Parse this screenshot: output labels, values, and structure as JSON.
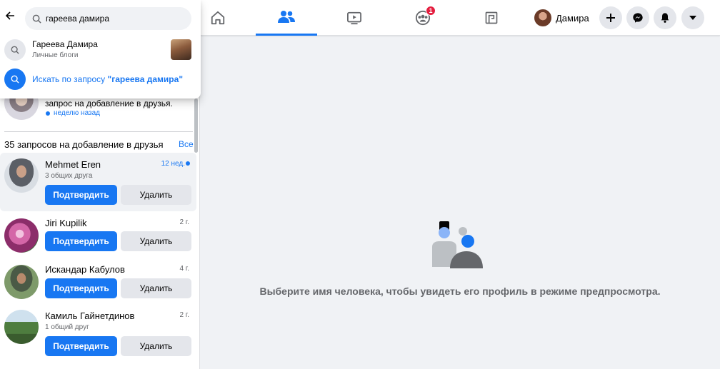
{
  "search": {
    "query": "гареева дамира",
    "suggestion": {
      "title": "Гареева Дамира",
      "subtitle": "Личные блоги"
    },
    "search_for_prefix": "Искать по запросу ",
    "search_for_query": "\"гареева дамира\""
  },
  "nav": {
    "tabs": [
      {
        "icon": "home-icon",
        "active": false
      },
      {
        "icon": "friends-icon",
        "active": true
      },
      {
        "icon": "watch-icon",
        "active": false
      },
      {
        "icon": "groups-icon",
        "active": false,
        "badge": "1"
      },
      {
        "icon": "gaming-icon",
        "active": false
      }
    ],
    "profile_name": "Дамира",
    "actions": [
      "plus-icon",
      "messenger-icon",
      "bell-icon",
      "caret-down-icon"
    ]
  },
  "notification": {
    "text": "запрос на добавление в друзья.",
    "time": "неделю назад"
  },
  "requests": {
    "title": "35 запросов на добавление в друзья",
    "see_all": "Все",
    "confirm_label": "Подтвердить",
    "delete_label": "Удалить",
    "items": [
      {
        "name": "Mehmet Eren",
        "time": "12 нед.",
        "mutual": "3 общих друга",
        "unread": true
      },
      {
        "name": "Jiri Kupilik",
        "time": "2 г.",
        "mutual": ""
      },
      {
        "name": "Искандар Кабулов",
        "time": "4 г.",
        "mutual": ""
      },
      {
        "name": "Камиль Гайнетдинов",
        "time": "2 г.",
        "mutual": "1 общий друг"
      }
    ]
  },
  "main": {
    "empty_text": "Выберите имя человека, чтобы увидеть его профиль в режиме предпросмотра."
  },
  "colors": {
    "accent": "#1877f2",
    "badge": "#e41e3f",
    "background": "#f0f2f5"
  }
}
